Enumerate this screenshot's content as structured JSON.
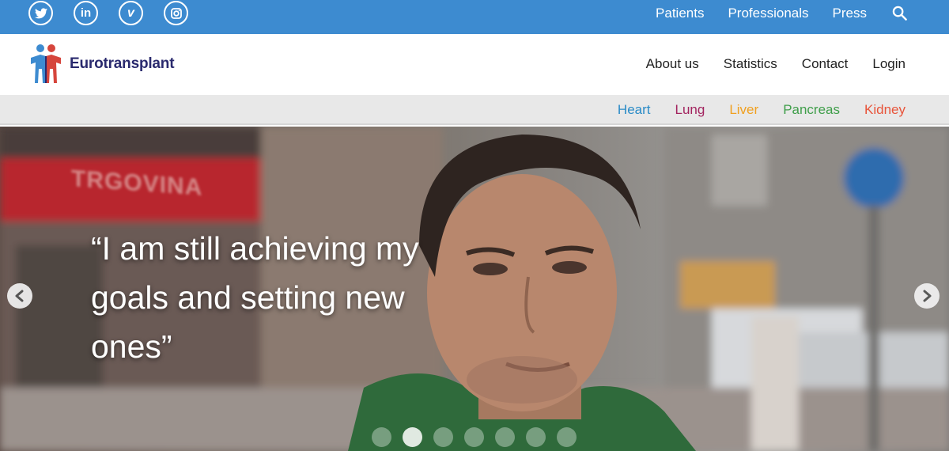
{
  "social": {
    "items": [
      {
        "name": "twitter-icon",
        "glyph": "t"
      },
      {
        "name": "linkedin-icon",
        "glyph": "in"
      },
      {
        "name": "vimeo-icon",
        "glyph": "v"
      },
      {
        "name": "instagram-icon",
        "glyph": "◎"
      }
    ]
  },
  "topnav": {
    "patients": "Patients",
    "professionals": "Professionals",
    "press": "Press",
    "search_icon": "search-icon"
  },
  "brand": {
    "name": "Eurotransplant",
    "colors": {
      "blue": "#3d8bd0",
      "red": "#d6453c",
      "navy": "#2a2a6e"
    }
  },
  "mainnav": {
    "about": "About us",
    "statistics": "Statistics",
    "contact": "Contact",
    "login": "Login"
  },
  "organs": {
    "heart": {
      "label": "Heart",
      "color": "#2a8bc7"
    },
    "lung": {
      "label": "Lung",
      "color": "#a3245f"
    },
    "liver": {
      "label": "Liver",
      "color": "#f0a020"
    },
    "pancreas": {
      "label": "Pancreas",
      "color": "#3f9e4a"
    },
    "kidney": {
      "label": "Kidney",
      "color": "#e8543a"
    }
  },
  "hero": {
    "quote": "“I am still achieving my goals and setting new ones”",
    "sign_text": "TRGOVINA",
    "slides_count": 7,
    "active_slide": 2
  }
}
